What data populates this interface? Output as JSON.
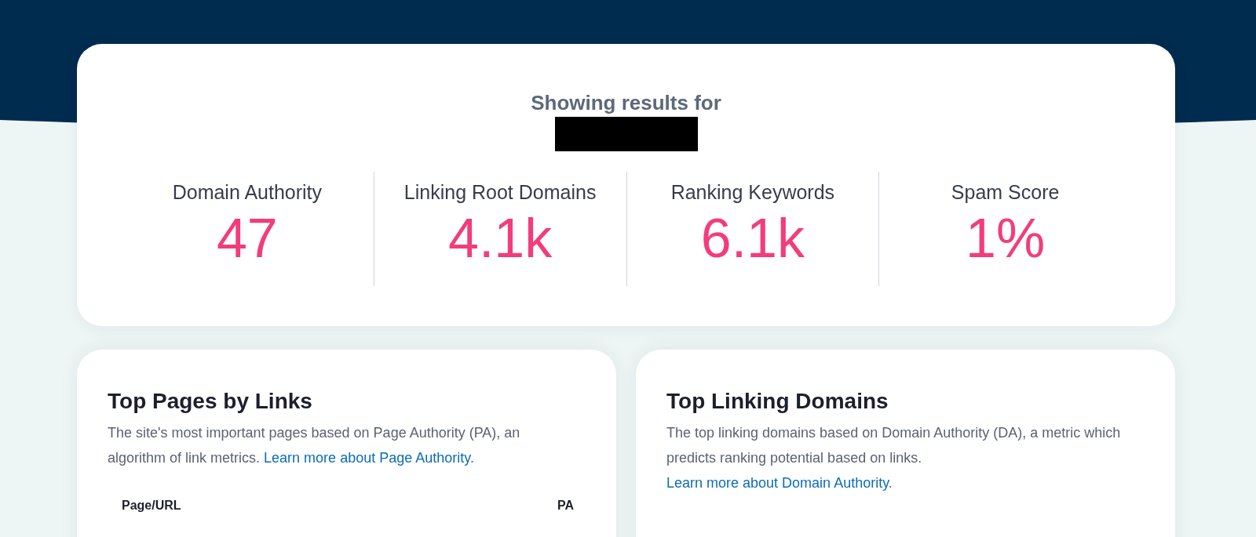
{
  "summary": {
    "heading": "Showing results for",
    "metrics": [
      {
        "label": "Domain Authority",
        "value": "47"
      },
      {
        "label": "Linking Root Domains",
        "value": "4.1k"
      },
      {
        "label": "Ranking Keywords",
        "value": "6.1k"
      },
      {
        "label": "Spam Score",
        "value": "1%"
      }
    ]
  },
  "panels": [
    {
      "title": "Top Pages by Links",
      "description": "The site's most important pages based on Page Authority (PA), an algorithm of link metrics.",
      "link": "Learn more about Page Authority",
      "link_end": ".",
      "columns": [
        "Page/URL",
        "PA"
      ]
    },
    {
      "title": "Top Linking Domains",
      "description": "The top linking domains based on Domain Authority (DA), a metric which predicts ranking potential based on links.",
      "link": "Learn more about Domain Authority",
      "link_end": "."
    }
  ]
}
